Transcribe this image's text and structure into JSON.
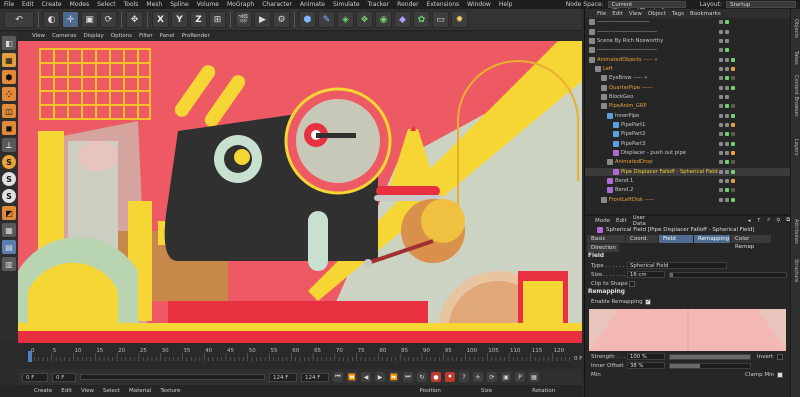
{
  "menu": {
    "items": [
      "File",
      "Edit",
      "Create",
      "Modes",
      "Select",
      "Tools",
      "Mesh",
      "Spline",
      "Volume",
      "MoGraph",
      "Character",
      "Animate",
      "Simulate",
      "Tracker",
      "Render",
      "Extensions",
      "Window",
      "Help"
    ],
    "node_space_label": "Node Space:",
    "node_space_value": "Current (Standard/Physical)",
    "layout_label": "Layout:",
    "layout_value": "Startup"
  },
  "toolbar": {
    "axis": [
      "X",
      "Y",
      "Z"
    ]
  },
  "viewport": {
    "menu": [
      "View",
      "Cameras",
      "Display",
      "Options",
      "Filter",
      "Panel",
      "ProRender"
    ]
  },
  "timeline": {
    "ticks": [
      "0",
      "5",
      "10",
      "15",
      "20",
      "25",
      "30",
      "35",
      "40",
      "45",
      "50",
      "55",
      "60",
      "65",
      "70",
      "75",
      "80",
      "85",
      "90",
      "95",
      "100",
      "105",
      "110",
      "115",
      "120"
    ],
    "end_label": "0 F",
    "current_frame": 0
  },
  "transport": {
    "start": "0 F",
    "start2": "0 F",
    "end": "124 F",
    "end2": "124 F"
  },
  "bottom": {
    "menu": [
      "Create",
      "Edit",
      "View",
      "Select",
      "Material",
      "Texture"
    ],
    "cols": [
      "Position",
      "Size",
      "Rotation"
    ]
  },
  "objects": {
    "menu": [
      "File",
      "Edit",
      "View",
      "Object",
      "Tags",
      "Bookmarks"
    ],
    "rows": [
      {
        "label": "----------------------------",
        "color": "#c8c8c8",
        "indent": 0,
        "icon": "#888"
      },
      {
        "label": "--------------------------------",
        "color": "#c8c8c8",
        "indent": 0,
        "icon": "#888"
      },
      {
        "label": "Scene By Rich Nosworthy",
        "color": "#c8c8c8",
        "indent": 0,
        "icon": "#888"
      },
      {
        "label": "--------------------------------",
        "color": "#c8c8c8",
        "indent": 0,
        "icon": "#888"
      },
      {
        "label": "AnimatedObjects ----- »",
        "color": "#e8a33a",
        "indent": 0,
        "icon": "#8a8a8a"
      },
      {
        "label": "Left",
        "color": "#e8a33a",
        "indent": 1,
        "icon": "#8a8a8a"
      },
      {
        "label": "EyeBrow ----- »",
        "color": "#c8c8c8",
        "indent": 2,
        "icon": "#8a8a8a"
      },
      {
        "label": "QuarterPipe ------",
        "color": "#e8a33a",
        "indent": 2,
        "icon": "#8a8a8a"
      },
      {
        "label": "BlockGeo",
        "color": "#c8c8c8",
        "indent": 2,
        "icon": "#8a8a8a"
      },
      {
        "label": "PipeAnim_GRP",
        "color": "#e8a33a",
        "indent": 2,
        "icon": "#8a8a8a"
      },
      {
        "label": "InnerPipe",
        "color": "#c8c8c8",
        "indent": 3,
        "icon": "#5aa0e0"
      },
      {
        "label": "PipePart1",
        "color": "#c8c8c8",
        "indent": 4,
        "icon": "#5aa0e0"
      },
      {
        "label": "PipePart2",
        "color": "#c8c8c8",
        "indent": 4,
        "icon": "#5aa0e0"
      },
      {
        "label": "PipePart3",
        "color": "#c8c8c8",
        "indent": 4,
        "icon": "#5aa0e0"
      },
      {
        "label": "Displacer - push out pipe",
        "color": "#c8c8c8",
        "indent": 4,
        "icon": "#b06ad8"
      },
      {
        "label": "AnimatedDrop",
        "color": "#e8a33a",
        "indent": 3,
        "icon": "#8a8a8a"
      },
      {
        "label": "Pipe Displacer Falloff - Spherical Field",
        "color": "#f0d040",
        "indent": 4,
        "icon": "#b06ad8"
      },
      {
        "label": "Bend.1",
        "color": "#c8c8c8",
        "indent": 3,
        "icon": "#b06ad8"
      },
      {
        "label": "Bend.2",
        "color": "#c8c8c8",
        "indent": 3,
        "icon": "#b06ad8"
      },
      {
        "label": "FrontLeftDisk -----",
        "color": "#e8a33a",
        "indent": 2,
        "icon": "#8a8a8a"
      }
    ]
  },
  "attributes": {
    "menu": [
      "Mode",
      "Edit",
      "User Data"
    ],
    "title": "Spherical Field [Pipe Displacer Falloff - Spherical Field]",
    "tabs": [
      "Basic",
      "Coord.",
      "Field",
      "Remapping",
      "Color Remap"
    ],
    "tab2": "Direction",
    "field_header": "Field",
    "type_label": "Type . . . . . . . . .",
    "type_value": "Spherical Field",
    "size_label": "Size. . . . . . . . .",
    "size_value": "16 cm",
    "clip_label": "Clip to Shape",
    "remap_header": "Remapping",
    "enable_label": "Enable Remapping",
    "strength_label": "Strength . . . . . .",
    "strength_value": "100 %",
    "strength": 1.0,
    "invert_label": "Invert",
    "inner_label": "Inner Offset",
    "inner_value": "38 %",
    "inner": 0.38,
    "min_label": "Min",
    "clamp_label": "Clamp Min"
  },
  "sidestrip": {
    "labels": [
      "Objects",
      "Takes",
      "Content Browser",
      "Layers",
      "Attributes",
      "Structure"
    ]
  }
}
